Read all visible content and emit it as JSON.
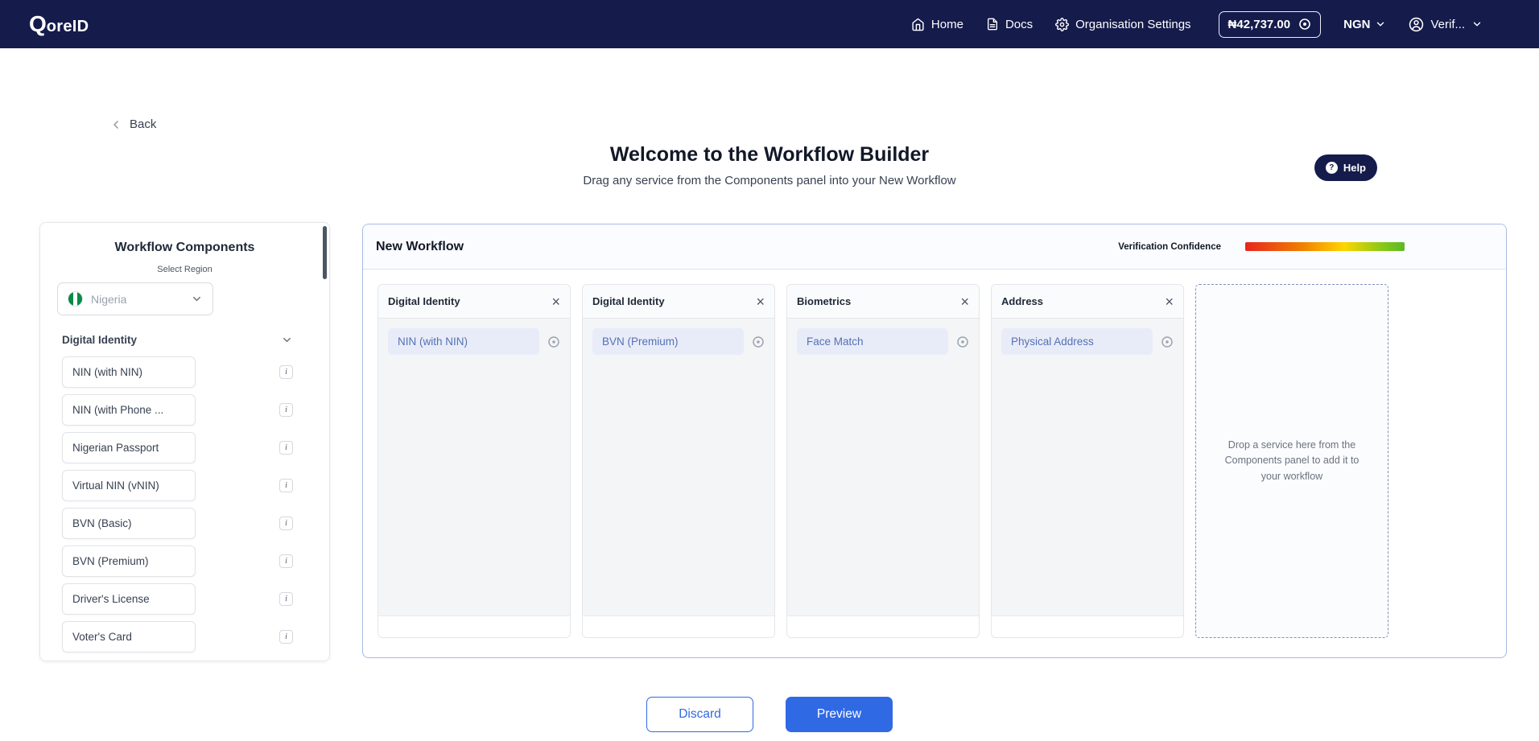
{
  "icons": {
    "close_glyph": "×",
    "info_glyph": "i",
    "help_glyph": "?"
  },
  "navbar": {
    "brand_initial": "Q",
    "brand_rest": "oreID",
    "items": [
      {
        "label": "Home",
        "icon": "home-icon"
      },
      {
        "label": "Docs",
        "icon": "docs-icon"
      },
      {
        "label": "Organisation Settings",
        "icon": "gear-icon"
      }
    ],
    "wallet_balance": "₦42,737.00",
    "currency": "NGN",
    "user_label": "Verif..."
  },
  "header": {
    "back_label": "Back",
    "title": "Welcome to the Workflow Builder",
    "subtitle": "Drag any service from the Components panel into your New Workflow",
    "help_label": "Help"
  },
  "panel": {
    "title": "Workflow Components",
    "region_label": "Select Region",
    "region_value": "Nigeria",
    "section_label": "Digital Identity",
    "items": [
      "NIN (with NIN)",
      "NIN (with Phone ...",
      "Nigerian Passport",
      "Virtual NIN (vNIN)",
      "BVN (Basic)",
      "BVN (Premium)",
      "Driver's License",
      "Voter's Card"
    ]
  },
  "workflow": {
    "title": "New Workflow",
    "confidence_label": "Verification Confidence",
    "columns": [
      {
        "category": "Digital Identity",
        "service": "NIN (with NIN)"
      },
      {
        "category": "Digital Identity",
        "service": "BVN (Premium)"
      },
      {
        "category": "Biometrics",
        "service": "Face Match"
      },
      {
        "category": "Address",
        "service": "Physical Address"
      }
    ],
    "dropzone_text": "Drop a service here from the Components panel to add it to your workflow"
  },
  "actions": {
    "discard_label": "Discard",
    "preview_label": "Preview"
  },
  "colors": {
    "navbar_bg": "#151b4b",
    "accent_blue": "#3069e4",
    "chip_bg": "#e8ecf8",
    "chip_text": "#5570b4",
    "confidence_gradient": [
      "#e8251f",
      "#f07d00",
      "#ffd500",
      "#5bb826"
    ]
  }
}
